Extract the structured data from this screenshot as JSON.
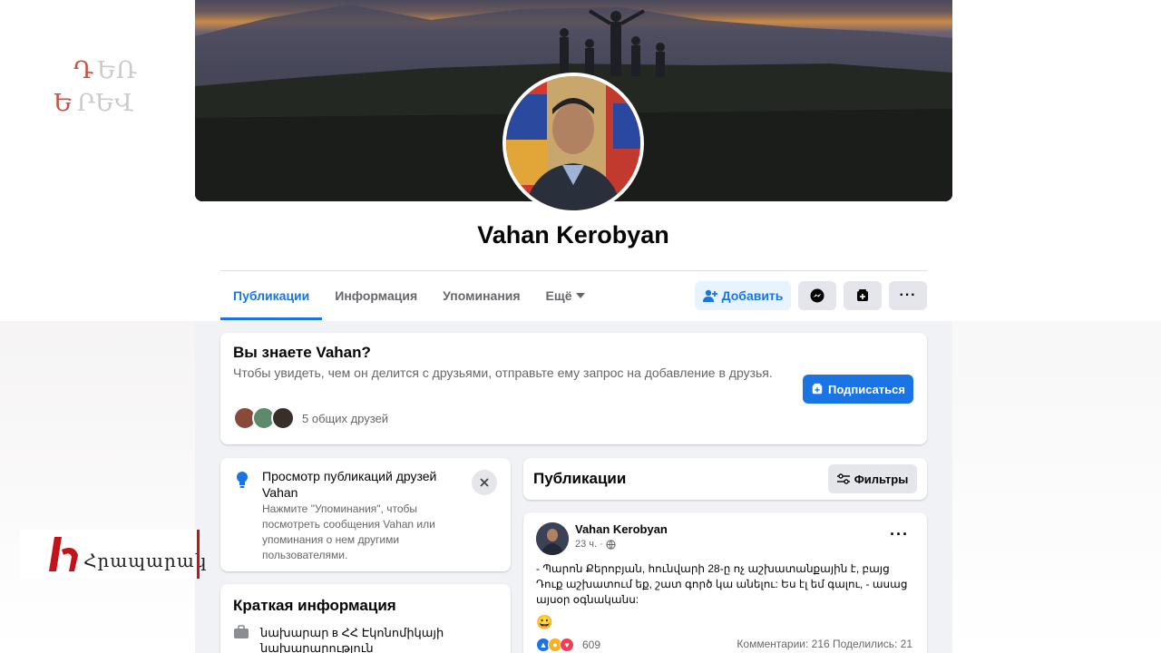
{
  "profile": {
    "name": "Vahan Kerobyan"
  },
  "tabs": [
    {
      "label": "Публикации",
      "active": true
    },
    {
      "label": "Информация"
    },
    {
      "label": "Упоминания"
    },
    {
      "label": "Ещё"
    }
  ],
  "actions": {
    "add_label": "Добавить",
    "messenger_icon": "messenger-icon",
    "follow_icon": "follow-icon",
    "more_icon": "more-dots-icon"
  },
  "know_card": {
    "title": "Вы знаете Vahan?",
    "description": "Чтобы увидеть, чем он делится с друзьями, отправьте ему запрос на добавление в друзья.",
    "mutual_friends": "5 общих друзей",
    "follow_label": "Подписаться"
  },
  "tip_card": {
    "title": "Просмотр публикаций друзей Vahan",
    "description": "Нажмите \"Упоминания\", чтобы посмотреть сообщения Vahan или упоминания о нем другими пользователями."
  },
  "info_card": {
    "title": "Краткая информация",
    "item": "նախարար в ՀՀ Էկոնոմիկայի նախարարություն"
  },
  "posts_header": {
    "title": "Публикации",
    "filter_label": "Фильтры"
  },
  "post": {
    "author": "Vahan Kerobyan",
    "time": "23 ч. ·",
    "more": "···",
    "text": "- Պարոն Քերոբյան, հունվարի 28-ը ոչ աշխատանքային է, բայց Դուք աշխատում եք, շատ գործ կա անելու: Ես էլ եմ գալու, - ասաց այսօր օգնականս:",
    "emoji": "😀",
    "reactions_count": "609",
    "stats": "Комментарии: 216  Поделились: 21"
  },
  "overlays": {
    "logo_top": "ԴԵՌ ԵՐԵՎ",
    "logo_bottom": "Հրապարակ"
  },
  "colors": {
    "accent": "#1b74e4",
    "background": "#f0f2f5",
    "muted_text": "#65676b"
  }
}
